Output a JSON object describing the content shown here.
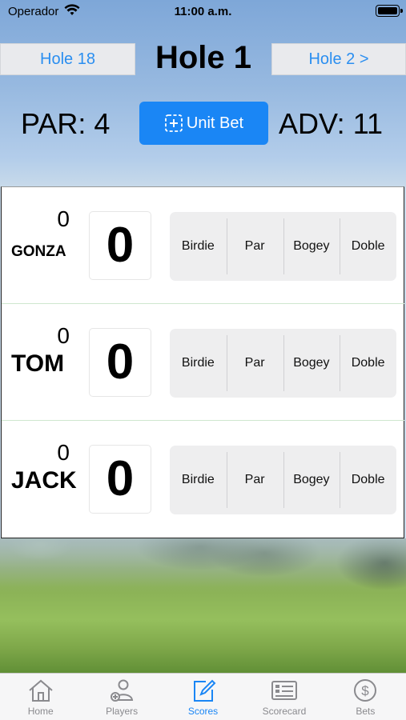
{
  "status_bar": {
    "carrier": "Operador",
    "time": "11:00 a.m."
  },
  "hole": {
    "title": "Hole 1",
    "prev_label": "Hole 18",
    "next_label": "Hole 2 >",
    "par": "PAR: 4",
    "adv": "ADV: 11"
  },
  "unit_bet": {
    "label": "Unit Bet"
  },
  "players": [
    {
      "name": "GONZA",
      "total": "0",
      "score": "0"
    },
    {
      "name": "TOM",
      "total": "0",
      "score": "0"
    },
    {
      "name": "JACK",
      "total": "0",
      "score": "0"
    }
  ],
  "score_options": [
    "Birdie",
    "Par",
    "Bogey",
    "Doble"
  ],
  "tabs": [
    {
      "label": "Home",
      "icon": "home-icon"
    },
    {
      "label": "Players",
      "icon": "add-player-icon"
    },
    {
      "label": "Scores",
      "icon": "edit-icon",
      "active": true
    },
    {
      "label": "Scorecard",
      "icon": "scorecard-icon"
    },
    {
      "label": "Bets",
      "icon": "dollar-icon"
    }
  ],
  "colors": {
    "accent": "#1a86f5",
    "nav_text": "#2a8ef0",
    "inactive_tab": "#8a8a8e"
  }
}
